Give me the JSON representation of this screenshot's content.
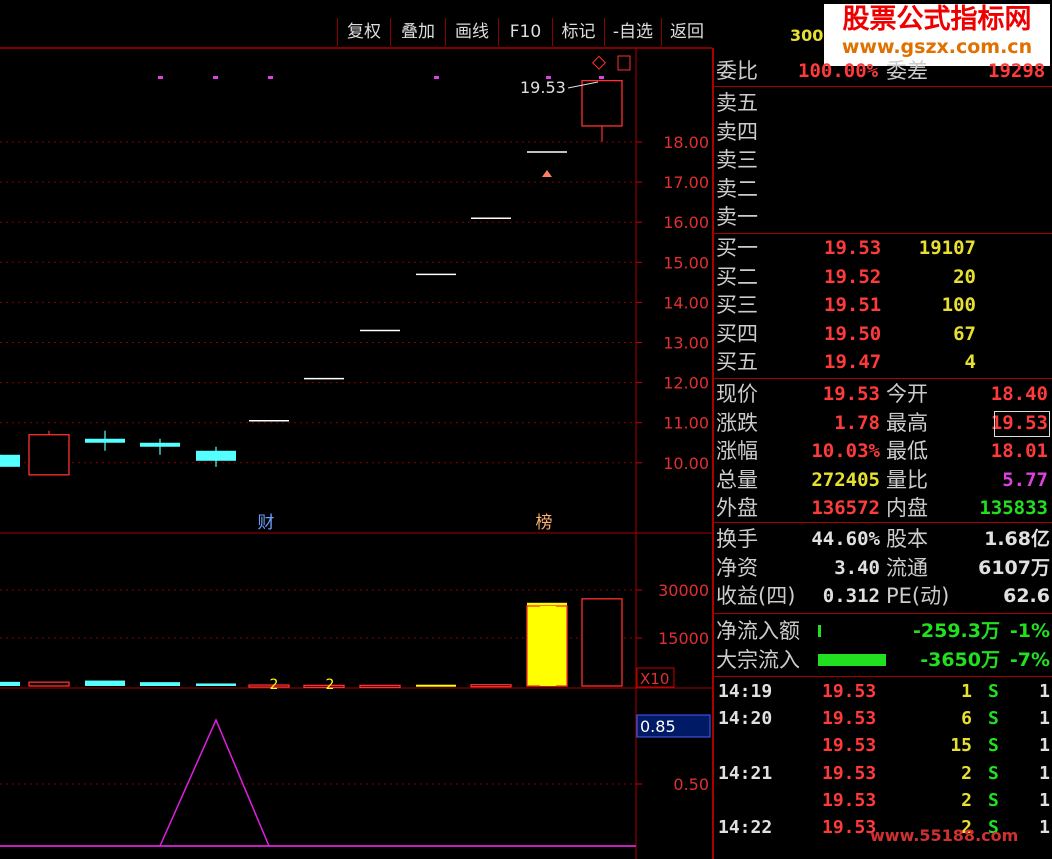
{
  "toolbar": {
    "buttons": [
      "复权",
      "叠加",
      "画线",
      "F10",
      "标记",
      "-自选",
      "返回"
    ]
  },
  "header": {
    "code_fragment": "300"
  },
  "watermark": {
    "line1": "股票公式指标网",
    "line2": "www.gszx.com.cn"
  },
  "bottom_watermark": "www.55188.com",
  "chart_data": {
    "type": "candlestick",
    "price_axis": {
      "ticks": [
        "18.00",
        "17.00",
        "16.00",
        "15.00",
        "14.00",
        "13.00",
        "12.00",
        "11.00",
        "10.00"
      ]
    },
    "volume_axis": {
      "ticks": [
        "30000",
        "15000"
      ],
      "unit": "X10"
    },
    "indicator_axis": {
      "ticks": [
        "0.85",
        "0.50"
      ],
      "current": "0.85"
    },
    "last_price_label": "19.53",
    "markers": [
      "财",
      "榜"
    ],
    "candles": [
      {
        "o": 10.2,
        "h": 10.2,
        "l": 9.9,
        "c": 9.9,
        "color": "cyan"
      },
      {
        "o": 9.7,
        "h": 10.8,
        "l": 9.7,
        "c": 10.7,
        "color": "red"
      },
      {
        "o": 10.6,
        "h": 10.8,
        "l": 10.3,
        "c": 10.5,
        "color": "cyan"
      },
      {
        "o": 10.5,
        "h": 10.6,
        "l": 10.2,
        "c": 10.4,
        "color": "cyan"
      },
      {
        "o": 10.3,
        "h": 10.4,
        "l": 9.9,
        "c": 10.05,
        "color": "cyan"
      },
      {
        "o": 11.05,
        "h": 11.05,
        "l": 11.05,
        "c": 11.05,
        "color": "white"
      },
      {
        "o": 12.1,
        "h": 12.1,
        "l": 12.1,
        "c": 12.1,
        "color": "white"
      },
      {
        "o": 13.3,
        "h": 13.3,
        "l": 13.3,
        "c": 13.3,
        "color": "white"
      },
      {
        "o": 14.7,
        "h": 14.7,
        "l": 14.7,
        "c": 14.7,
        "color": "white"
      },
      {
        "o": 16.1,
        "h": 16.1,
        "l": 16.1,
        "c": 16.1,
        "color": "white"
      },
      {
        "o": 17.75,
        "h": 17.75,
        "l": 17.75,
        "c": 17.75,
        "color": "white"
      },
      {
        "o": 18.4,
        "h": 19.53,
        "l": 18.01,
        "c": 19.53,
        "color": "red"
      }
    ],
    "volumes": [
      {
        "v": 1300,
        "color": "cyan"
      },
      {
        "v": 1200,
        "color": "red"
      },
      {
        "v": 1700,
        "color": "cyan"
      },
      {
        "v": 1200,
        "color": "cyan"
      },
      {
        "v": 800,
        "color": "cyan"
      },
      {
        "v": 300,
        "color": "red"
      },
      {
        "v": 200,
        "color": "red"
      },
      {
        "v": 200,
        "color": "red"
      },
      {
        "v": 400,
        "color": "yellow"
      },
      {
        "v": 400,
        "color": "red"
      },
      {
        "v": 26000,
        "color": "yellow"
      },
      {
        "v": 27240,
        "color": "red"
      }
    ],
    "volume_labels": [
      "2",
      "2"
    ],
    "indicator": [
      0,
      0,
      0,
      0,
      0,
      0,
      0.85,
      0,
      0,
      0,
      0,
      0
    ]
  },
  "panel": {
    "weibi": {
      "label": "委比",
      "value": "100.00%",
      "label2": "委差",
      "value2": "19298"
    },
    "sell": [
      {
        "label": "卖五"
      },
      {
        "label": "卖四"
      },
      {
        "label": "卖三"
      },
      {
        "label": "卖二"
      },
      {
        "label": "卖一"
      }
    ],
    "buy": [
      {
        "label": "买一",
        "price": "19.53",
        "vol": "19107"
      },
      {
        "label": "买二",
        "price": "19.52",
        "vol": "20"
      },
      {
        "label": "买三",
        "price": "19.51",
        "vol": "100"
      },
      {
        "label": "买四",
        "price": "19.50",
        "vol": "67"
      },
      {
        "label": "买五",
        "price": "19.47",
        "vol": "4"
      }
    ],
    "quote": [
      {
        "l1": "现价",
        "v1": "19.53",
        "c1": "red",
        "l2": "今开",
        "v2": "18.40",
        "c2": "red"
      },
      {
        "l1": "涨跌",
        "v1": "1.78",
        "c1": "red",
        "l2": "最高",
        "v2": "19.53",
        "c2": "red"
      },
      {
        "l1": "涨幅",
        "v1": "10.03%",
        "c1": "red",
        "l2": "最低",
        "v2": "18.01",
        "c2": "red"
      },
      {
        "l1": "总量",
        "v1": "272405",
        "c1": "yel",
        "l2": "量比",
        "v2": "5.77",
        "c2": "mag"
      },
      {
        "l1": "外盘",
        "v1": "136572",
        "c1": "red",
        "l2": "内盘",
        "v2": "135833",
        "c2": "grn"
      }
    ],
    "fin": [
      {
        "l1": "换手",
        "v1": "44.60%",
        "l2": "股本",
        "v2": "1.68亿"
      },
      {
        "l1": "净资",
        "v1": "3.40",
        "l2": "流通",
        "v2": "6107万"
      },
      {
        "l1": "收益(四)",
        "v1": "0.312",
        "l2": "PE(动)",
        "v2": "62.6"
      }
    ],
    "flow": [
      {
        "label": "净流入额",
        "value": "-259.3万",
        "pct": "-1%",
        "bar": 0.04
      },
      {
        "label": "大宗流入",
        "value": "-3650万",
        "pct": "-7%",
        "bar": 0.9
      }
    ],
    "trades": [
      {
        "time": "14:19",
        "price": "19.53",
        "vol": "1",
        "side": "S",
        "n": "1"
      },
      {
        "time": "14:20",
        "price": "19.53",
        "vol": "6",
        "side": "S",
        "n": "1"
      },
      {
        "time": "",
        "price": "19.53",
        "vol": "15",
        "side": "S",
        "n": "1"
      },
      {
        "time": "14:21",
        "price": "19.53",
        "vol": "2",
        "side": "S",
        "n": "1"
      },
      {
        "time": "",
        "price": "19.53",
        "vol": "2",
        "side": "S",
        "n": "1"
      },
      {
        "time": "14:22",
        "price": "19.53",
        "vol": "2",
        "side": "S",
        "n": "1"
      }
    ]
  }
}
